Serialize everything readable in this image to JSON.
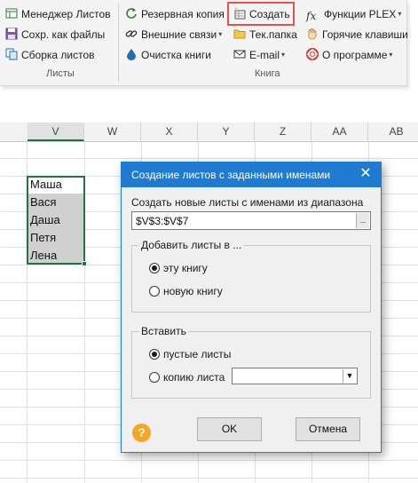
{
  "ribbon": {
    "sheets_group": {
      "items": [
        {
          "label": "Менеджер Листов",
          "icon": "sheet-manager-icon"
        },
        {
          "label": "Сохр. как файлы",
          "icon": "save-files-icon"
        },
        {
          "label": "Сборка листов",
          "icon": "assemble-sheets-icon"
        }
      ],
      "group_label": "Листы"
    },
    "book_group": {
      "col1": [
        {
          "label": "Резервная копия",
          "icon": "backup-icon"
        },
        {
          "label": "Внешние связи",
          "icon": "links-icon",
          "dropdown": "▾"
        },
        {
          "label": "Очистка книги",
          "icon": "clean-icon"
        }
      ],
      "col2": [
        {
          "label": "Создать",
          "icon": "create-icon"
        },
        {
          "label": "Тек.папка",
          "icon": "folder-icon"
        },
        {
          "label": "E-mail",
          "icon": "email-icon",
          "dropdown": "▾"
        }
      ],
      "col3": [
        {
          "label": "Функции PLEX",
          "icon": "fx-icon",
          "dropdown": "▾"
        },
        {
          "label": "Горячие клавиши",
          "icon": "hotkeys-icon"
        },
        {
          "label": "О программе",
          "icon": "about-icon",
          "dropdown": "▾"
        }
      ],
      "group_label": "Книга"
    }
  },
  "sheet": {
    "columns": [
      "V",
      "W",
      "X",
      "Y",
      "Z",
      "AA",
      "AB"
    ],
    "active_column": "V",
    "cells": [
      "Маша",
      "Вася",
      "Даша",
      "Петя",
      "Лена"
    ]
  },
  "dialog": {
    "title": "Создание листов с заданными именами",
    "close": "✕",
    "range_label": "Создать новые листы с именами из диапазона",
    "range_value": "$V$3:$V$7",
    "range_button": "_",
    "add_group": {
      "title": "Добавить листы в ...",
      "options": [
        {
          "label": "эту книгу",
          "selected": true
        },
        {
          "label": "новую книгу",
          "selected": false
        }
      ]
    },
    "insert_group": {
      "title": "Вставить",
      "options": [
        {
          "label": "пустые листы",
          "selected": true
        },
        {
          "label": "копию листа",
          "selected": false
        }
      ],
      "combo_value": "",
      "combo_arrow": "▼"
    },
    "ok_label": "OK",
    "cancel_label": "Отмена",
    "help_label": "?"
  },
  "colors": {
    "title_bar": "#1f7ad2",
    "highlight": "#e5534b",
    "selection": "#217346",
    "help": "#f5a623"
  }
}
